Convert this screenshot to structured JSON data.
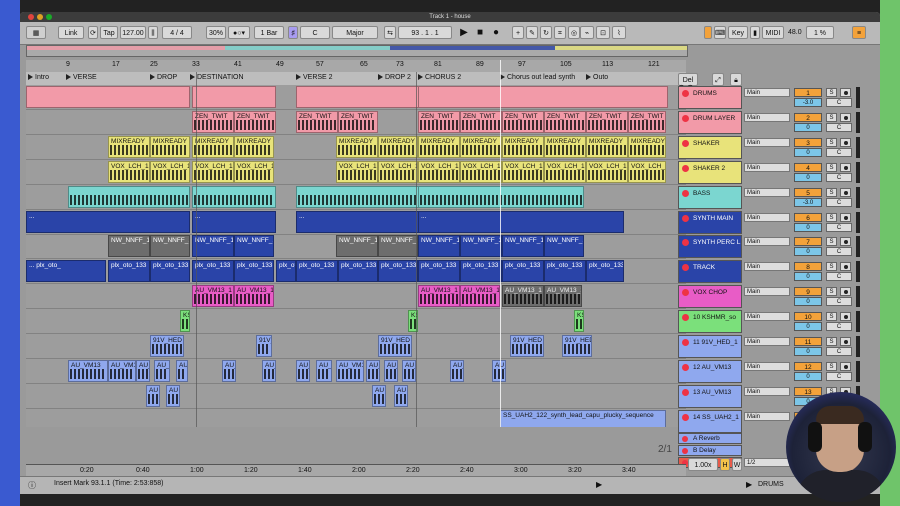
{
  "window": {
    "title": "Track 1 - house"
  },
  "controls": {
    "link": "Link",
    "tap": "Tap",
    "tempo": "127.00",
    "signature": "4 / 4",
    "metronome": "30%",
    "quantize": "1 Bar",
    "key": "C",
    "scale": "Major",
    "position": "93 .  1 .  1",
    "key_label": "Key",
    "midi_label": "MIDI",
    "cpu": "48.0",
    "cpu_pct": "1 %"
  },
  "ruler_bars": [
    "9",
    "17",
    "25",
    "33",
    "41",
    "49",
    "57",
    "65",
    "73",
    "81",
    "89",
    "97",
    "105",
    "113",
    "121"
  ],
  "locators": [
    "Intro",
    "VERSE",
    "DROP",
    "DESTINATION",
    "VERSE 2",
    "DROP 2",
    "CHORUS 2",
    "Chorus out lead synth",
    "Outo"
  ],
  "clip_labels": {
    "zen": "ZEN_TWIT",
    "mix": "MIXREADY",
    "vox": "VOX_LCH_1",
    "dots": "...",
    "nw": "NW_NNFF_1",
    "plx": "plx_oto_133",
    "plx_first": "... plx_oto_",
    "au13": "AU_VM13_1",
    "k": "KS",
    "hed": "91V_HED",
    "au": "AU",
    "au_vm": "AU_VM13",
    "ss": "SS_UAH2_122_synth_lead_capu_plucky_sequence"
  },
  "tracks": [
    {
      "name": "DRUMS",
      "color": "#f29aa8",
      "num": "1",
      "vol": "-3.0",
      "route": "Main",
      "pan": "C"
    },
    {
      "name": "DRUM LAYER",
      "color": "#f29aa8",
      "num": "2",
      "vol": "0",
      "route": "Main",
      "pan": "C"
    },
    {
      "name": "SHAKER",
      "color": "#e8e37a",
      "num": "3",
      "vol": "0",
      "route": "Main",
      "pan": "C"
    },
    {
      "name": "SHAKER 2",
      "color": "#e8e37a",
      "num": "4",
      "vol": "0",
      "route": "Main",
      "pan": "C"
    },
    {
      "name": "BASS",
      "color": "#7bd6d0",
      "num": "5",
      "vol": "-3.0",
      "route": "Main",
      "pan": "C"
    },
    {
      "name": "SYNTH MAIN",
      "color": "#2a44a8",
      "num": "6",
      "vol": "0",
      "route": "Main",
      "pan": "C"
    },
    {
      "name": "SYNTH PERC L",
      "color": "#2a44a8",
      "num": "7",
      "vol": "0",
      "route": "Main",
      "pan": "C"
    },
    {
      "name": "TRACK",
      "color": "#2a44a8",
      "num": "8",
      "vol": "0",
      "route": "Main",
      "pan": "C"
    },
    {
      "name": "VOX CHOP",
      "color": "#e85cc6",
      "num": "9",
      "vol": "0",
      "route": "Main",
      "pan": "C"
    },
    {
      "name": "10 KSHMR_so",
      "color": "#7be07b",
      "num": "10",
      "vol": "0",
      "route": "Main",
      "pan": "C"
    },
    {
      "name": "11 91V_HED_1",
      "color": "#8fa8ee",
      "num": "11",
      "vol": "0",
      "route": "Main",
      "pan": "C"
    },
    {
      "name": "12 AU_VM13",
      "color": "#8fa8ee",
      "num": "12",
      "vol": "0",
      "route": "Main",
      "pan": "C"
    },
    {
      "name": "13 AU_VM13",
      "color": "#8fa8ee",
      "num": "13",
      "vol": "0",
      "route": "Main",
      "pan": "C"
    },
    {
      "name": "14 SS_UAH2_1",
      "color": "#8fa8ee",
      "num": "14",
      "vol": "0",
      "route": "Main",
      "pan": "C"
    }
  ],
  "returns": [
    {
      "name": "A Reverb",
      "color": "#8fa8ee"
    },
    {
      "name": "B Delay",
      "color": "#8fa8ee"
    },
    {
      "name": "Main",
      "color": "#e85a4a"
    }
  ],
  "return_del": "Del",
  "main_ratio": "1/2",
  "zoom_fraction": "2/1",
  "zoom": "1.00x",
  "timeline": [
    "0:20",
    "0:40",
    "1:00",
    "1:20",
    "1:40",
    "2:00",
    "2:20",
    "2:40",
    "3:00",
    "3:20",
    "3:40"
  ],
  "status": {
    "text": "Insert Mark 93.1.1 (Time: 2:53:858)",
    "track": "DRUMS"
  },
  "hw": {
    "h": "H",
    "w": "W"
  }
}
